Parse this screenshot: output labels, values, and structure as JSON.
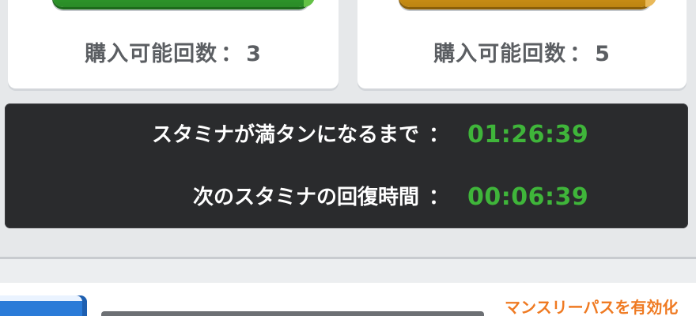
{
  "purchase_cards": [
    {
      "label": "購入可能回数",
      "separator": "：",
      "count": "3",
      "button_color": "#2f9a2c"
    },
    {
      "label": "購入可能回数",
      "separator": "：",
      "count": "5",
      "button_color": "#cf9419"
    }
  ],
  "stamina": {
    "full_label": "スタミナが満タンになるまで",
    "full_colon": "：",
    "full_time": "01:26:39",
    "next_label": "次のスタミナの回復時間",
    "next_colon": "：",
    "next_time": "00:06:39",
    "time_color": "#3fb53a"
  },
  "monthly_pass": {
    "link_text": "マンスリーパスを有効化"
  }
}
